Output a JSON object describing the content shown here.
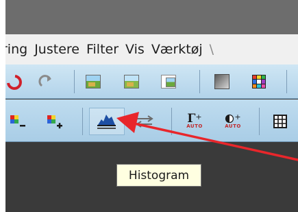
{
  "menubar": {
    "items": [
      {
        "label": "ring"
      },
      {
        "label": "Justere"
      },
      {
        "label": "Filter"
      },
      {
        "label": "Vis"
      },
      {
        "label": "Værktøj"
      },
      {
        "label": "\\"
      }
    ]
  },
  "toolbar": {
    "row1_icons": [
      "undo-icon",
      "redo-icon",
      "image-adjust-icon",
      "image-copy-icon",
      "image-paste-icon",
      "grayscale-icon",
      "color-palette-icon"
    ],
    "row2_icons": [
      "decrease-color-icon",
      "increase-color-icon",
      "histogram-icon",
      "levels-icon",
      "gamma-auto-icon",
      "contrast-auto-icon",
      "grid-icon"
    ],
    "gamma_symbol": "Γ",
    "plus": "+",
    "auto_label": "AUTO"
  },
  "tooltip": {
    "text": "Histogram"
  },
  "annotation": {
    "arrow_color": "#e8262b"
  }
}
